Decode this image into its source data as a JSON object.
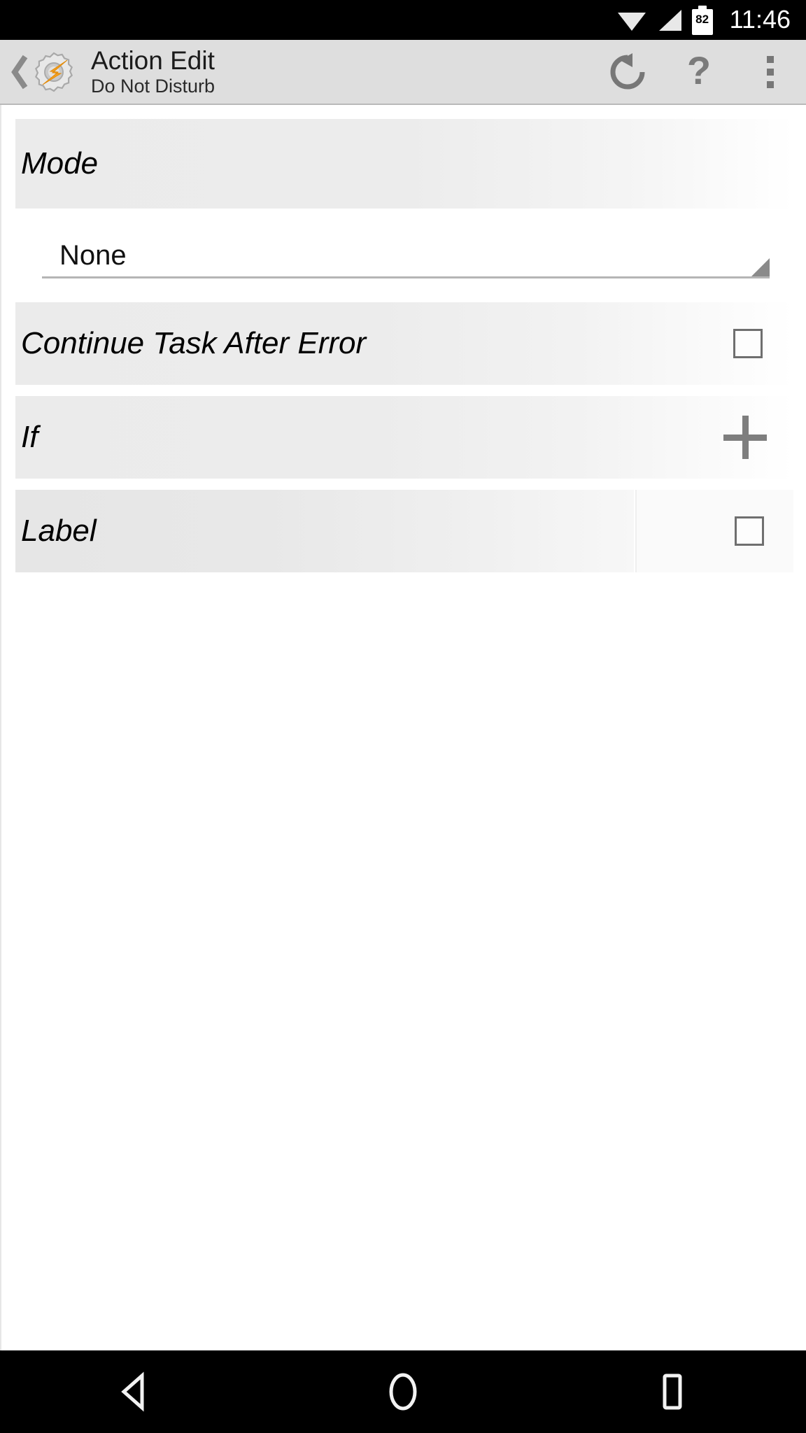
{
  "status_bar": {
    "wifi_icon": "wifi-icon",
    "signal_icon": "cell-signal-icon",
    "battery_icon": "battery-icon",
    "battery_level": "82",
    "time": "11:46"
  },
  "action_bar": {
    "back_icon": "back-chevron-icon",
    "app_icon": "tasker-logo-icon",
    "title": "Action Edit",
    "subtitle": "Do Not Disturb",
    "actions": [
      {
        "name": "reset-icon",
        "label": "Reset"
      },
      {
        "name": "help-icon",
        "label": "?"
      },
      {
        "name": "overflow-menu-icon",
        "label": "More options"
      }
    ]
  },
  "main": {
    "section_header": {
      "label": "Mode"
    },
    "mode_spinner": {
      "value": "None",
      "dropdown_icon": "dropdown-triangle-icon"
    },
    "rows": [
      {
        "label": "Continue Task After Error",
        "control": "checkbox",
        "checked": false
      },
      {
        "label": "If",
        "control": "plus",
        "plus_icon": "plus-icon"
      },
      {
        "label": "Label",
        "control": "checkbox",
        "checked": false
      }
    ]
  },
  "nav_bar": {
    "back": "nav-back-icon",
    "home": "nav-home-icon",
    "recents": "nav-recents-icon"
  },
  "colors": {
    "status_bar_bg": "#000000",
    "action_bar_bg": "#dedede",
    "content_bg": "#ffffff",
    "row_gradient_start": "#ebebeb",
    "text_primary": "#000000",
    "icon_gray": "#777777",
    "accent_orange": "#f5a01e"
  }
}
